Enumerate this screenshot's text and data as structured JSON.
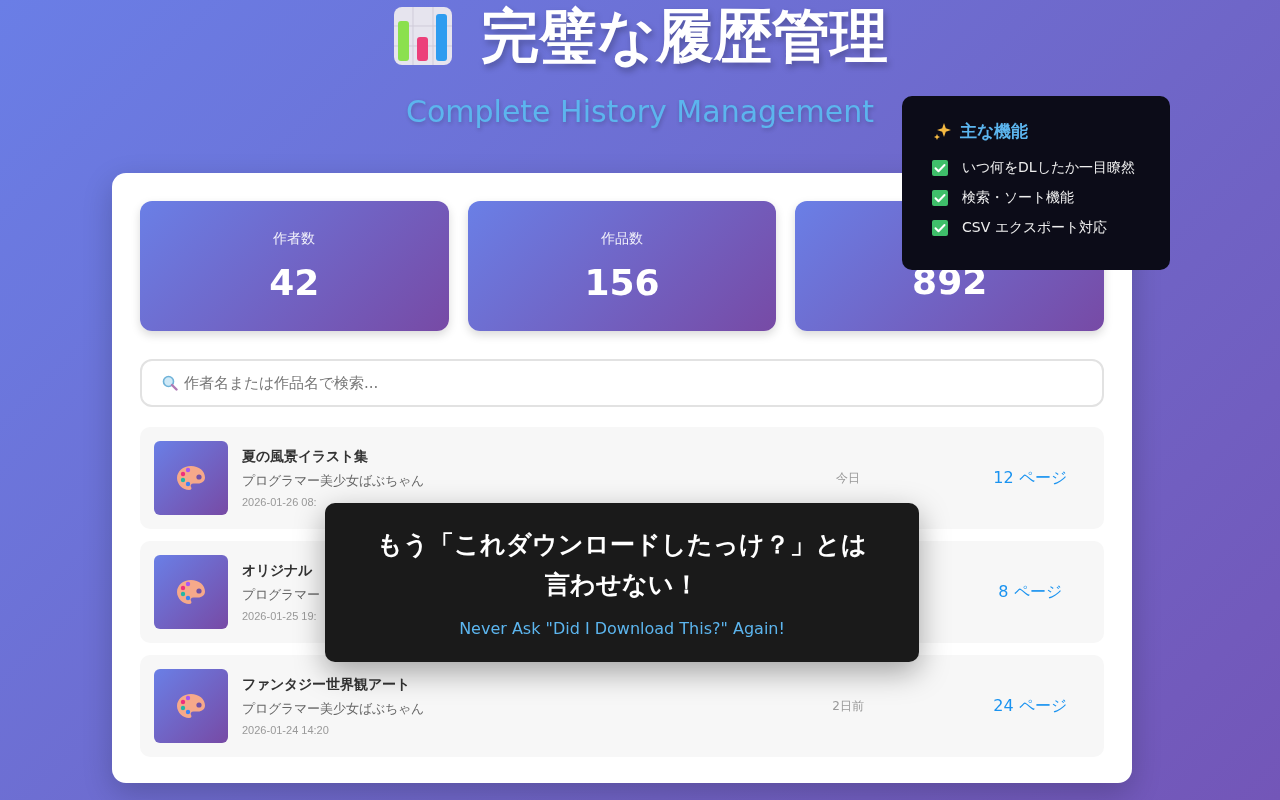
{
  "header": {
    "title": "完璧な履歴管理",
    "subtitle": "Complete History Management"
  },
  "stats": [
    {
      "label": "作者数",
      "value": "42"
    },
    {
      "label": "作品数",
      "value": "156"
    },
    {
      "value": "892"
    }
  ],
  "search": {
    "placeholder": "作者名または作品名で検索..."
  },
  "works": [
    {
      "title": "夏の風景イラスト集",
      "author": "プログラマー美少女ばぶちゃん",
      "date": "2026-01-26 08:",
      "relative": "今日",
      "pages": "12 ページ"
    },
    {
      "title": "オリジナル",
      "author": "プログラマー",
      "date": "2026-01-25 19:",
      "pages": "8 ページ"
    },
    {
      "title": "ファンタジー世界観アート",
      "author": "プログラマー美少女ばぶちゃん",
      "date": "2026-01-24 14:20",
      "relative": "2日前",
      "pages": "24 ページ"
    }
  ],
  "features": {
    "title": "主な機能",
    "items": [
      {
        "label": "いつ何をDLしたか一目瞭然",
        "checked": true
      },
      {
        "label": "検索・ソート機能",
        "checked": true
      },
      {
        "label": "CSV エクスポート対応",
        "checked": true
      }
    ]
  },
  "banner": {
    "headline": "もう「これダウンロードしたっけ？」とは言わせない！",
    "subline": "Never Ask \"Did I Download This?\" Again!"
  }
}
